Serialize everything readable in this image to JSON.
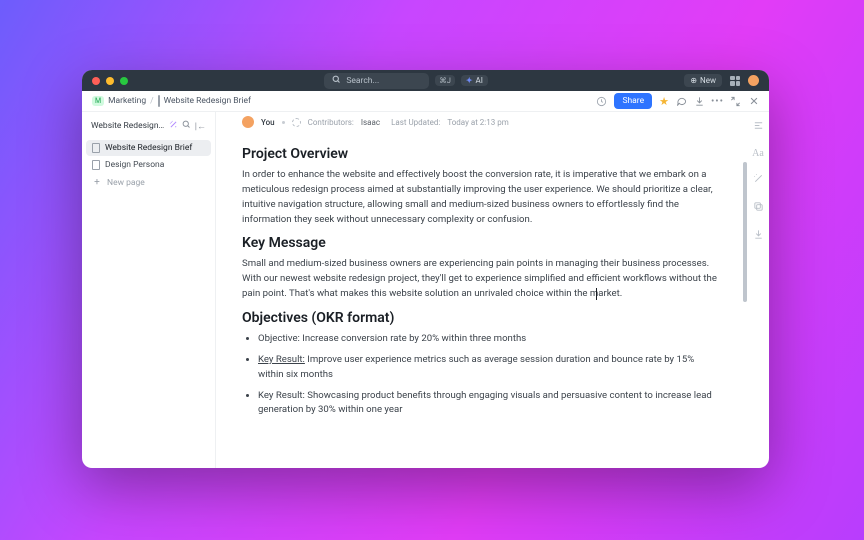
{
  "titlebar": {
    "search_placeholder": "Search...",
    "kbd_hint": "⌘J",
    "ai_label": "AI",
    "new_label": "New"
  },
  "subhead": {
    "crumb_root": "Marketing",
    "crumb_page": "Website Redesign Brief",
    "share_label": "Share"
  },
  "sidebar": {
    "title": "Website Redesign Brief",
    "items": [
      {
        "label": "Website Redesign Brief",
        "active": true
      },
      {
        "label": "Design Persona",
        "active": false
      }
    ],
    "new_page": "New page"
  },
  "meta": {
    "you": "You",
    "contributors_label": "Contributors:",
    "contributor_name": "Isaac",
    "updated_label": "Last Updated:",
    "updated_value": "Today at 2:13 pm"
  },
  "doc": {
    "h1": "Project Overview",
    "p1": "In order to enhance the website and effectively boost the conversion rate, it is imperative that we embark on a meticulous redesign process aimed at substantially improving the user experience. We should prioritize a clear, intuitive navigation structure, allowing small and medium-sized business owners to effortlessly find the information they seek without unnecessary complexity or confusion.",
    "h2": "Key Message",
    "p2": "Small and medium-sized business owners are experiencing pain points in managing their business processes. With our newest website redesign project, they'll get to experience simplified and efficient workflows without the pain point. That's what makes this website solution an unrivaled choice within the market.",
    "h3": "Objectives (OKR format)",
    "li1": "Objective: Increase conversion rate by 20% within three months",
    "li2_kr": "Key Result:",
    "li2_rest": " Improve user experience metrics such as average session duration and bounce rate by 15% within six months",
    "li3": "Key Result: Showcasing product benefits through engaging visuals and persuasive content to increase lead generation by 30% within one year"
  }
}
